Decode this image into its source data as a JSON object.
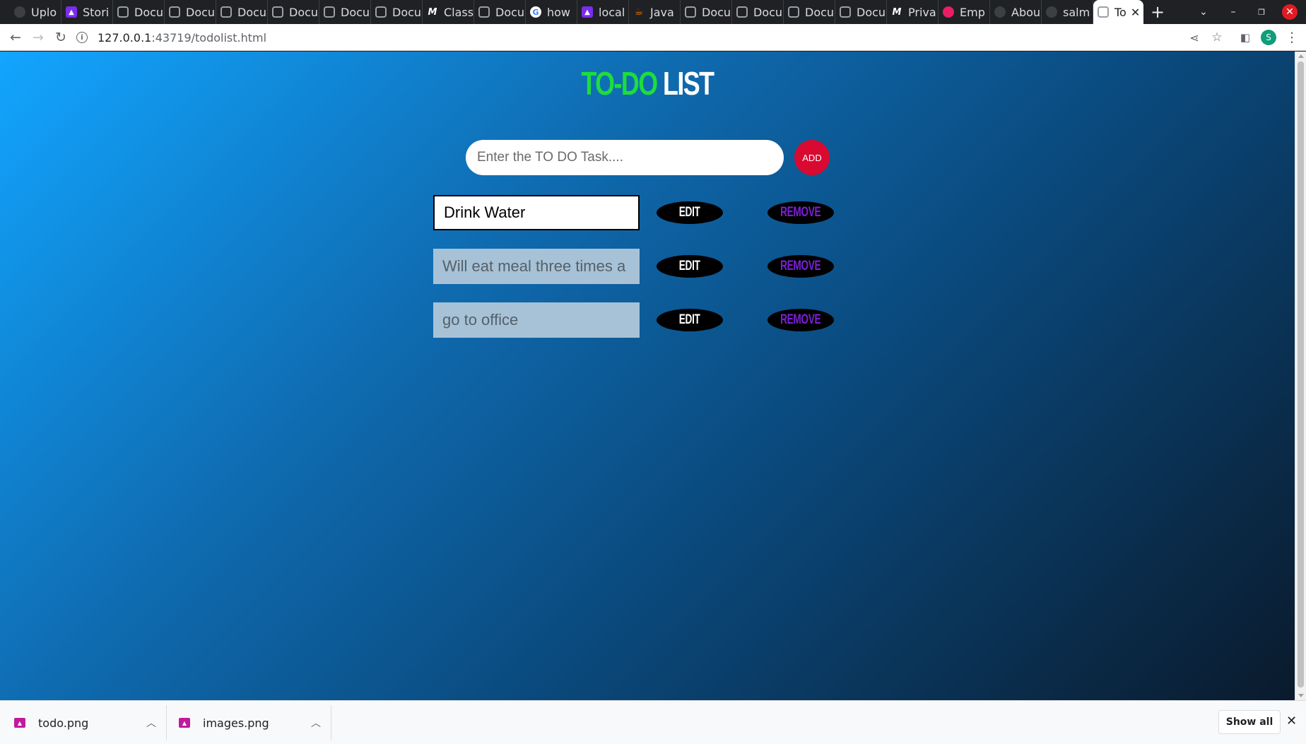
{
  "browser": {
    "tabs": [
      {
        "label": "Uplo",
        "icon": "github-icon"
      },
      {
        "label": "Stori",
        "icon": "purple-app-icon"
      },
      {
        "label": "Docu",
        "icon": "code-icon"
      },
      {
        "label": "Docu",
        "icon": "code-icon"
      },
      {
        "label": "Docu",
        "icon": "code-icon"
      },
      {
        "label": "Docu",
        "icon": "code-icon"
      },
      {
        "label": "Docu",
        "icon": "code-icon"
      },
      {
        "label": "Docu",
        "icon": "code-icon"
      },
      {
        "label": "Class",
        "icon": "medium-icon"
      },
      {
        "label": "Docu",
        "icon": "code-icon"
      },
      {
        "label": "how",
        "icon": "google-icon"
      },
      {
        "label": "local",
        "icon": "purple-app-icon"
      },
      {
        "label": "Java",
        "icon": "java-icon"
      },
      {
        "label": "Docu",
        "icon": "code-icon"
      },
      {
        "label": "Docu",
        "icon": "code-icon"
      },
      {
        "label": "Docu",
        "icon": "code-icon"
      },
      {
        "label": "Docu",
        "icon": "code-icon"
      },
      {
        "label": "Priva",
        "icon": "medium-icon"
      },
      {
        "label": "Emp",
        "icon": "pink-app-icon"
      },
      {
        "label": "Abou",
        "icon": "github-icon"
      },
      {
        "label": "salm",
        "icon": "github-icon"
      }
    ],
    "active_tab": {
      "label": "To",
      "icon": "code-icon"
    },
    "url_host": "127.0.0.1",
    "url_rest": ":43719/todolist.html",
    "profile_initial": "S"
  },
  "app": {
    "title_part1": "TO-DO",
    "title_part2": "LIST",
    "input_placeholder": "Enter the TO DO Task....",
    "add_label": "ADD",
    "todos": [
      {
        "text": "Drink Water",
        "editing": true,
        "edit_label": "EDIT",
        "remove_label": "REMOVE"
      },
      {
        "text": "Will eat meal three times a day",
        "editing": false,
        "edit_label": "EDIT",
        "remove_label": "REMOVE"
      },
      {
        "text": "go to office",
        "editing": false,
        "edit_label": "EDIT",
        "remove_label": "REMOVE"
      }
    ]
  },
  "downloads": {
    "items": [
      {
        "name": "todo.png"
      },
      {
        "name": "images.png"
      }
    ],
    "show_all_label": "Show all"
  },
  "colors": {
    "title_accent": "#1ddd3d",
    "add_button": "#d80a32",
    "remove_text": "#7a1fd6",
    "gradient_start": "#12a5ff",
    "gradient_end": "#0a1a2c"
  }
}
